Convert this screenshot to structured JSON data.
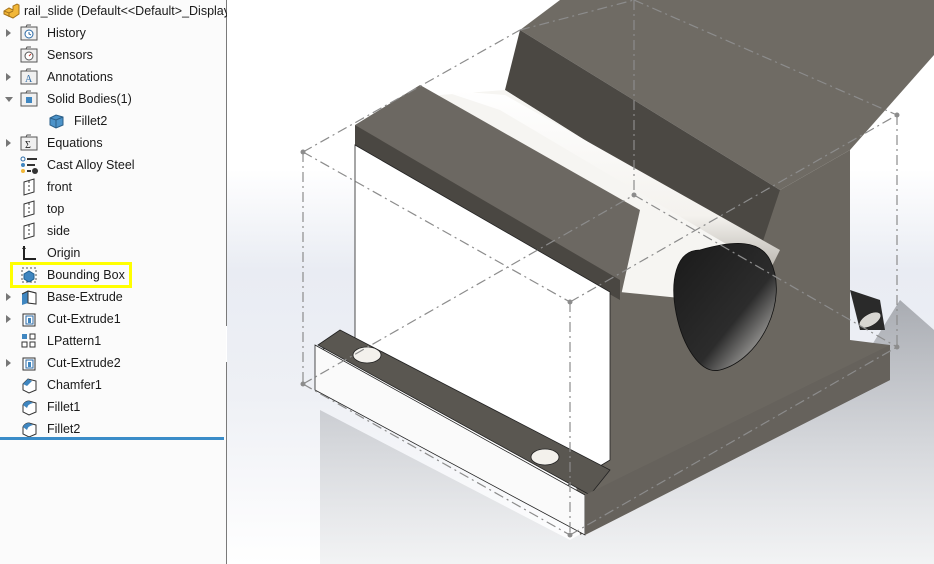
{
  "feature_tree": {
    "root": {
      "label": "rail_slide  (Default<<Default>_Display",
      "icon": "part-icon"
    },
    "items": [
      {
        "label": "History",
        "icon": "history-folder-icon",
        "expander": "collapsed"
      },
      {
        "label": "Sensors",
        "icon": "sensors-folder-icon",
        "expander": "none"
      },
      {
        "label": "Annotations",
        "icon": "annotations-folder-icon",
        "expander": "collapsed"
      },
      {
        "label": "Solid Bodies(1)",
        "icon": "solid-bodies-folder-icon",
        "expander": "expanded"
      },
      {
        "label": "Fillet2",
        "icon": "solid-body-icon",
        "expander": "none",
        "indent": 1
      },
      {
        "label": "Equations",
        "icon": "equations-folder-icon",
        "expander": "collapsed"
      },
      {
        "label": "Cast Alloy Steel",
        "icon": "material-icon",
        "expander": "none"
      },
      {
        "label": "front",
        "icon": "plane-icon",
        "expander": "none"
      },
      {
        "label": "top",
        "icon": "plane-icon",
        "expander": "none"
      },
      {
        "label": "side",
        "icon": "plane-icon",
        "expander": "none"
      },
      {
        "label": "Origin",
        "icon": "origin-icon",
        "expander": "none"
      },
      {
        "label": "Bounding Box",
        "icon": "bounding-box-icon",
        "expander": "none",
        "highlighted": true
      },
      {
        "label": "Base-Extrude",
        "icon": "extrude-icon",
        "expander": "collapsed"
      },
      {
        "label": "Cut-Extrude1",
        "icon": "cut-extrude-icon",
        "expander": "collapsed"
      },
      {
        "label": "LPattern1",
        "icon": "linear-pattern-icon",
        "expander": "none"
      },
      {
        "label": "Cut-Extrude2",
        "icon": "cut-extrude-icon",
        "expander": "collapsed"
      },
      {
        "label": "Chamfer1",
        "icon": "chamfer-icon",
        "expander": "none"
      },
      {
        "label": "Fillet1",
        "icon": "fillet-icon",
        "expander": "none"
      },
      {
        "label": "Fillet2",
        "icon": "fillet-icon",
        "expander": "none"
      }
    ],
    "highlight_color": "#ffff00",
    "rollback_bar_color": "#3a8cc8"
  },
  "viewport": {
    "model": "rail_slide",
    "display": "shaded with edges, bounding box shown",
    "colors": {
      "metal_dark": "#58554f",
      "metal_top": "#716d66",
      "metal_face": "#6a665f",
      "bounding_box_line": "#8c8c8c",
      "highlight": "#ffffff"
    }
  }
}
